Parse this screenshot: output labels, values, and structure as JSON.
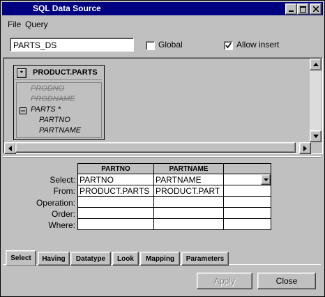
{
  "window": {
    "title": "SQL Data Source"
  },
  "menu": {
    "file": "File",
    "query": "Query"
  },
  "datasource": {
    "name": "PARTS_DS",
    "global_label": "Global",
    "global_checked": false,
    "allow_insert_label": "Allow insert",
    "allow_insert_checked": true
  },
  "diagram": {
    "table_title": "PRODUCT.PARTS",
    "star": "*",
    "columns": [
      "PRODNO",
      "PRODNAME",
      "PARTS *",
      "PARTNO",
      "PARTNAME"
    ]
  },
  "grid": {
    "row_labels": [
      "Select:",
      "From:",
      "Operation:",
      "Order:",
      "Where:"
    ],
    "headers": [
      "PARTNO",
      "PARTNAME",
      ""
    ],
    "select": [
      "PARTNO",
      "PARTNAME",
      ""
    ],
    "from": [
      "PRODUCT.PARTS",
      "PRODUCT.PART",
      ""
    ]
  },
  "tabs": [
    "Select",
    "Having",
    "Datatype",
    "Look",
    "Mapping",
    "Parameters"
  ],
  "buttons": {
    "apply": "Apply",
    "close": "Close"
  }
}
